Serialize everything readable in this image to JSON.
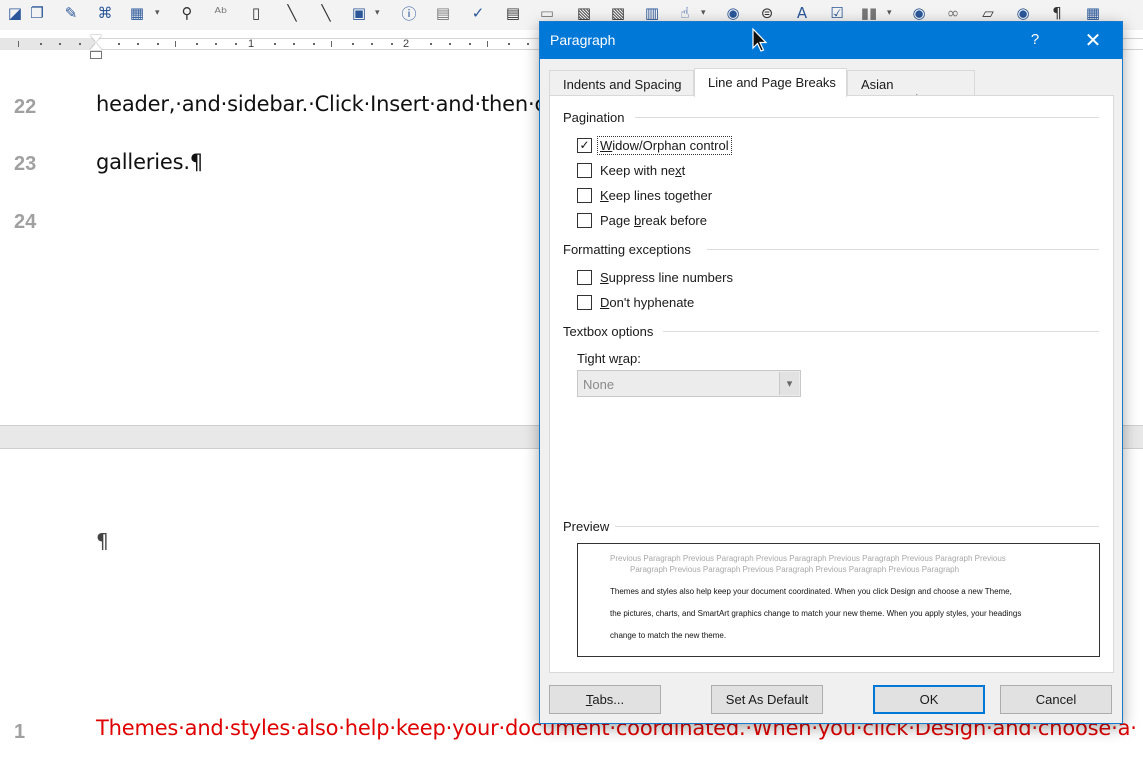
{
  "toolbar": {
    "icons": [
      "shape-icon",
      "smartart-icon",
      "signature-icon",
      "hierarchy-icon",
      "table-icon",
      "search-icon",
      "text-effects-icon",
      "page-icon",
      "line-icon",
      "line2-icon",
      "textbox-icon",
      "info-icon",
      "form-icon",
      "check-icon",
      "document-icon",
      "frame-icon",
      "doc-icon",
      "doc2-icon",
      "form-field-icon",
      "touch-icon",
      "record-icon",
      "currency-icon",
      "voice-icon",
      "check-image-icon",
      "barcode-icon",
      "record2-icon",
      "link-icon",
      "folder-icon",
      "record3-icon",
      "pilcrow-icon",
      "table-edit-icon"
    ]
  },
  "ruler": {
    "num1": "1",
    "num2": "2"
  },
  "document": {
    "line22_num": "22",
    "line22_text": "header,·and·sidebar.·Click·Insert·and·then·cho",
    "line23_num": "23",
    "line23_text": "galleries.¶",
    "line24_num": "24",
    "pilcrow": "¶",
    "line1_num": "1",
    "line1_text": "Themes·and·styles·also·help·keep·your·document·coordinated.·When·you·click·Design·and·choose·a·"
  },
  "dialog": {
    "title": "Paragraph",
    "help": "?",
    "close": "✕",
    "tabs": [
      {
        "label": "Indents and Spacing",
        "active": false
      },
      {
        "label": "Line and Page Breaks",
        "active": true
      },
      {
        "label": "Asian Typography",
        "active": false
      }
    ],
    "pagination": {
      "header": "Pagination",
      "widow_orphan": "Widow/Orphan control",
      "keep_with_next": "Keep with next",
      "keep_lines_together": "Keep lines together",
      "page_break_before": "Page break before"
    },
    "formatting": {
      "header": "Formatting exceptions",
      "suppress_line_numbers": "Suppress line numbers",
      "dont_hyphenate": "Don't hyphenate"
    },
    "textbox": {
      "header": "Textbox options",
      "tight_wrap_label": "Tight wrap:",
      "tight_wrap_value": "None"
    },
    "checks": {
      "widow_orphan": true,
      "keep_with_next": false,
      "keep_lines_together": false,
      "page_break_before": false,
      "suppress_line_numbers": false,
      "dont_hyphenate": false
    },
    "preview": {
      "header": "Preview",
      "prev1": "Previous Paragraph Previous Paragraph Previous Paragraph Previous Paragraph Previous Paragraph Previous",
      "prev2": "Paragraph Previous Paragraph Previous Paragraph Previous Paragraph Previous Paragraph",
      "cur1": "Themes and styles also help keep your document coordinated. When you click Design and choose a new Theme,",
      "cur2": "the pictures, charts, and SmartArt graphics change to match your new theme. When you apply styles, your headings",
      "cur3": "change to match the new theme."
    },
    "buttons": {
      "tabs": "Tabs...",
      "set_default": "Set As Default",
      "ok": "OK",
      "cancel": "Cancel"
    }
  },
  "colors": {
    "title_bar": "#0078d7",
    "body_text_red": "#e00000"
  }
}
